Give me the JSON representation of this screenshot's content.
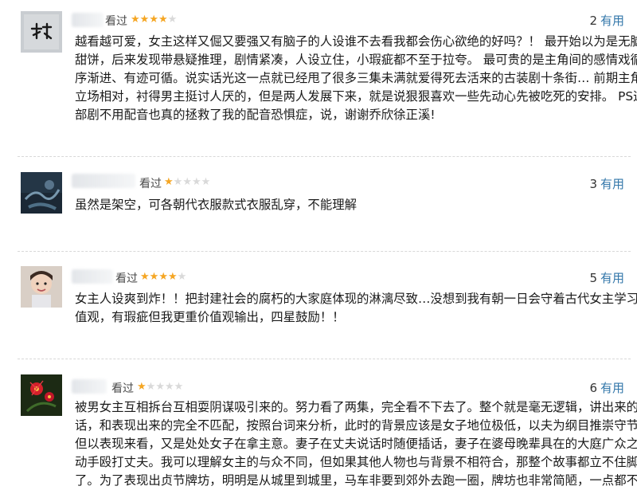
{
  "reviews": [
    {
      "status": "看过",
      "stars": 4,
      "useful_count": "2",
      "useful_label": "有用",
      "lines": [
        "越看越可爱，女主这样又倔又要强又有脑子的人设谁不去看我都会伤心欲绝的好吗？！ 最开始以为是无脑",
        "甜饼，后来发现带悬疑推理，剧情紧凑，人设立住，小瑕疵都不至于拉夸。 最可贵的是主角间的感情戏循",
        "序渐进、有迹可循。说实话光这一点就已经甩了很多三集未满就爱得死去活来的古装剧十条街… 前期主角",
        "立场相对，衬得男主挺讨人厌的，但是两人发展下来，就是说狠狠喜欢一些先动心先被吃死的安排。 PS这",
        "部剧不用配音也真的拯救了我的配音恐惧症，说，谢谢乔欣徐正溪!"
      ]
    },
    {
      "status": "看过",
      "stars": 1,
      "useful_count": "3",
      "useful_label": "有用",
      "lines": [
        "虽然是架空，可各朝代衣服款式衣服乱穿，不能理解"
      ]
    },
    {
      "status": "看过",
      "stars": 4,
      "useful_count": "5",
      "useful_label": "有用",
      "lines": [
        "女主人设爽到炸！！把封建社会的腐朽的大家庭体现的淋漓尽致…没想到我有朝一日会守着古代女主学习价",
        "值观，有瑕疵但我更重价值观输出，四星鼓励！！"
      ]
    },
    {
      "status": "看过",
      "stars": 1,
      "useful_count": "6",
      "useful_label": "有用",
      "lines": [
        "被男女主互相拆台互相耍阴谋吸引来的。努力看了两集，完全看不下去了。整个就是毫无逻辑，讲出来的",
        "话，和表现出来的完全不匹配，按照台词来分析，此时的背景应该是女子地位极低，以夫为纲目推崇守节，",
        "但以表现来看，又是处处女子在拿主意。妻子在丈夫说话时随便插话，妻子在婆母晚辈具在的大庭广众之下",
        "动手殴打丈夫。我可以理解女主的与众不同，但如果其他人物也与背景不相符合，那整个故事都立不住脚",
        "了。为了表现出贞节牌坊，明明是从城里到城里，马车非要到郊外去跑一圈，牌坊也非常简陋，一点都不像"
      ]
    }
  ]
}
